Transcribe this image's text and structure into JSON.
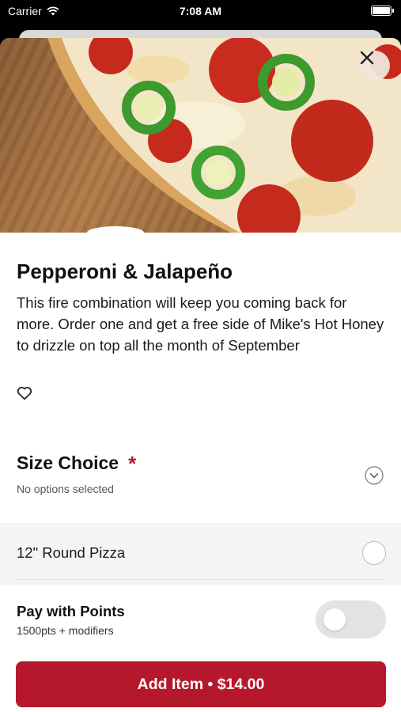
{
  "status_bar": {
    "carrier": "Carrier",
    "time": "7:08 AM"
  },
  "product": {
    "title": "Pepperoni & Jalapeño",
    "description": "This fire combination will keep you coming back for more. Order one and get a free side of Mike's Hot Honey to drizzle on top all the month of September",
    "favorite_icon": "heart-outline-icon"
  },
  "size_choice": {
    "title": "Size Choice",
    "required_marker": "*",
    "subtitle": "No options selected",
    "options": [
      {
        "label": "12\" Round Pizza"
      }
    ]
  },
  "points": {
    "title": "Pay with Points",
    "subtitle": "1500pts + modifiers",
    "enabled": false
  },
  "add_button": {
    "label": "Add Item • $14.00"
  },
  "colors": {
    "accent": "#b5172d"
  }
}
